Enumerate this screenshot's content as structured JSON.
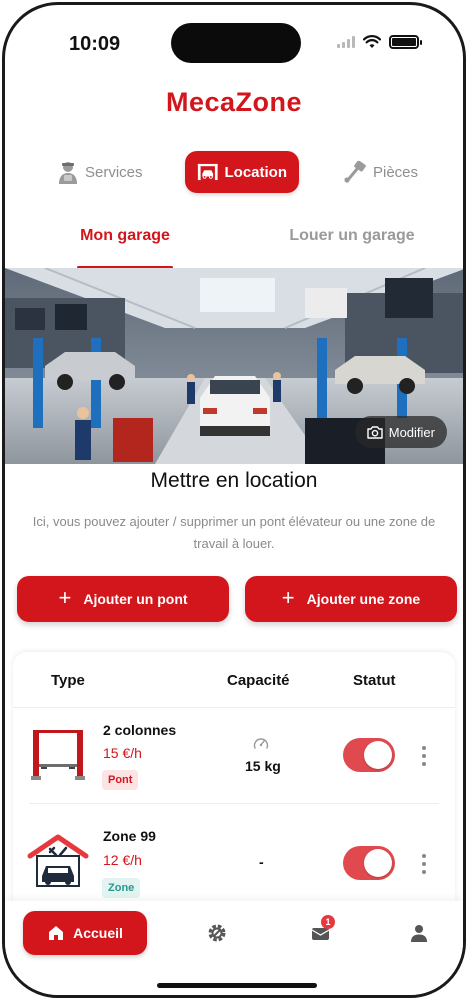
{
  "status_bar": {
    "time": "10:09"
  },
  "app": {
    "title": "MecaZone"
  },
  "segments": [
    {
      "label": "Services",
      "icon": "mechanic-icon"
    },
    {
      "label": "Location",
      "icon": "car-lift-icon",
      "active": true
    },
    {
      "label": "Pièces",
      "icon": "piston-icon"
    }
  ],
  "tabs": [
    {
      "label": "Mon garage",
      "active": true
    },
    {
      "label": "Louer un garage"
    }
  ],
  "hero": {
    "modify_label": "Modifier",
    "image": "garage-workshop-photo"
  },
  "section": {
    "title": "Mettre en location",
    "description": "Ici, vous pouvez ajouter / supprimer un pont élévateur ou une zone de travail à louer."
  },
  "actions": {
    "add_pont": "Ajouter un pont",
    "add_zone": "Ajouter une zone"
  },
  "table": {
    "headers": {
      "type": "Type",
      "capacity": "Capacité",
      "status": "Statut"
    },
    "rows": [
      {
        "name": "2 colonnes",
        "price": "15 €/h",
        "tag": "Pont",
        "capacity": "15 kg",
        "enabled": true,
        "icon": "two-post-lift-icon"
      },
      {
        "name": "Zone 99",
        "price": "12 €/h",
        "tag": "Zone",
        "capacity": "-",
        "enabled": true,
        "icon": "garage-zone-icon"
      }
    ]
  },
  "bottom_nav": {
    "home_label": "Accueil",
    "notification_count": "1"
  },
  "colors": {
    "accent": "#d2161c",
    "toggle_on": "#e04a4e",
    "zone_badge": "#27998c"
  }
}
